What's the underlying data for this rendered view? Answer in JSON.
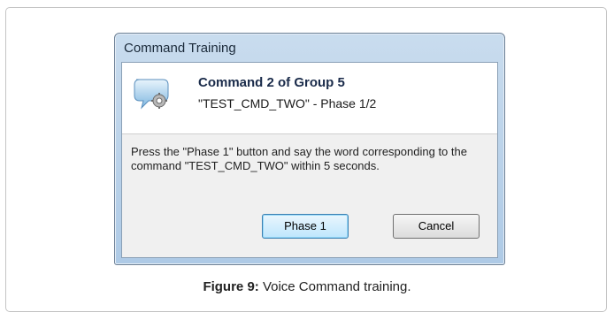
{
  "dialog": {
    "title": "Command Training",
    "heading": "Command 2 of Group 5",
    "subheading": "\"TEST_CMD_TWO\" - Phase 1/2",
    "instruction": "Press the \"Phase 1\" button and say the word corresponding to the command \"TEST_CMD_TWO\" within 5 seconds.",
    "icon": "speech-bubble-gear-icon",
    "buttons": {
      "phase1_label": "Phase 1",
      "cancel_label": "Cancel"
    }
  },
  "caption": {
    "label": "Figure 9:",
    "text": " Voice Command training."
  },
  "colors": {
    "titlebar": "#b9d1ea",
    "button_focus_border": "#3c7fb1"
  }
}
